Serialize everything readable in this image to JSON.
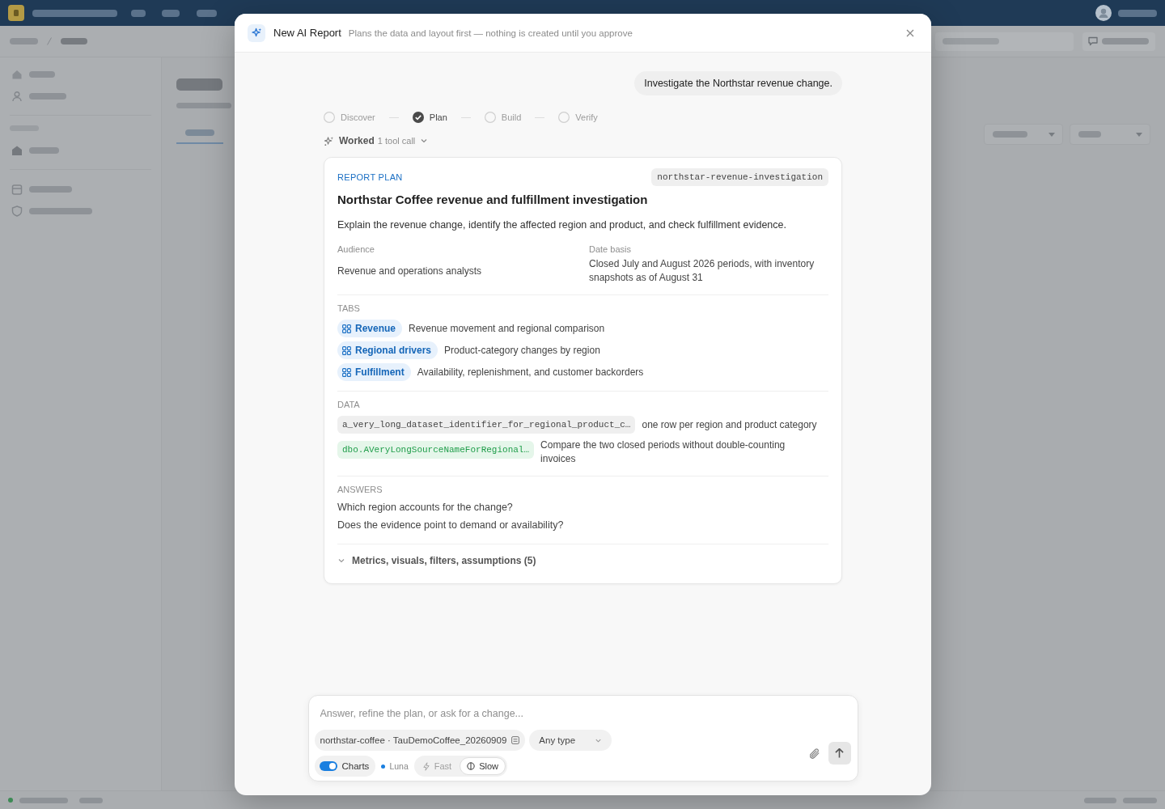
{
  "backdrop": {
    "tabs": [
      {
        "selected": true
      }
    ]
  },
  "dialog": {
    "title": "New AI Report",
    "subtitle": "Plans the data and layout first — nothing is created until you approve",
    "user_message": "Investigate the Northstar revenue change.",
    "steps": [
      {
        "label": "Discover",
        "checked": false
      },
      {
        "label": "Plan",
        "checked": true
      },
      {
        "label": "Build",
        "checked": false
      },
      {
        "label": "Verify",
        "checked": false
      }
    ],
    "activity": {
      "label": "Worked",
      "detail": "1 tool call",
      "expanded": false
    },
    "plan": {
      "eyebrow": "REPORT PLAN",
      "slug": "northstar-revenue-investigation",
      "title": "Northstar Coffee revenue and fulfillment investigation",
      "summary": "Explain the revenue change, identify the affected region and product, and check fulfillment evidence.",
      "fields": [
        {
          "label": "Audience",
          "value": "Revenue and operations analysts"
        },
        {
          "label": "Date basis",
          "value": "Closed July and August 2026 periods, with inventory snapshots as of August 31"
        }
      ],
      "tabs": {
        "heading": "TABS",
        "items": [
          {
            "name": "Revenue",
            "description": "Revenue movement and regional comparison"
          },
          {
            "name": "Regional drivers",
            "description": "Product-category changes by region"
          },
          {
            "name": "Fulfillment",
            "description": "Availability, replenishment, and customer backorders"
          }
        ]
      },
      "data": {
        "heading": "DATA",
        "items": [
          {
            "kind": "dataset",
            "name": "a_very_long_dataset_identifier_for_regional_product_c…",
            "description": "one row per region and product category"
          },
          {
            "kind": "source",
            "name": "dbo.AVeryLongSourceNameForRegional…",
            "description": "Compare the two closed periods without double-counting invoices"
          }
        ]
      },
      "answers": {
        "heading": "ANSWERS",
        "items": [
          "Which region accounts for the change?",
          "Does the evidence point to demand or availability?"
        ]
      },
      "details": {
        "label": "Metrics, visuals, filters, assumptions (5)",
        "expanded": false
      }
    },
    "composer": {
      "placeholder": "Answer, refine the plan, or ask for a change...",
      "source": "northstar-coffee · TauDemoCoffee_20260909",
      "type_filter": "Any type",
      "charts": {
        "label": "Charts",
        "on": true
      },
      "model": "Luna",
      "speed": [
        {
          "kind": "fast",
          "label": "Fast",
          "selected": false
        },
        {
          "kind": "slow",
          "label": "Slow",
          "selected": true
        }
      ]
    }
  }
}
